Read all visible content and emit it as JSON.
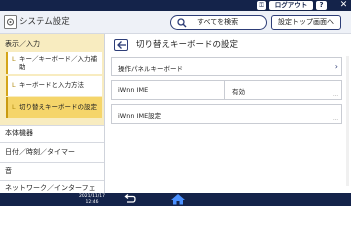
{
  "topbar": {
    "help_label": "?",
    "key_label": "⚿",
    "logout_label": "ログアウト",
    "close_label": "✕"
  },
  "header": {
    "title": "システム設定",
    "search_label": "すべてを検索",
    "top_button_label": "設定トップ画面へ"
  },
  "sidebar": {
    "group_title": "表示／入力",
    "sub_items": [
      {
        "line1": "キー／キーボード／入力補",
        "line2": "助",
        "selected": false
      },
      {
        "line1": "キーボードと入力方法",
        "selected": false
      },
      {
        "line1": "切り替えキーボードの設定",
        "selected": true
      }
    ],
    "items": [
      {
        "label": "本体機器"
      },
      {
        "label": "日付／時刻／タイマー"
      },
      {
        "label": "音"
      },
      {
        "label": "ネットワーク／インターフェ"
      }
    ]
  },
  "main": {
    "title": "切り替えキーボードの設定",
    "rows": [
      {
        "label": "操作パネルキーボード",
        "value": "",
        "kind": "nav"
      },
      {
        "label": "iWnn IME",
        "value": "有効",
        "kind": "value"
      },
      {
        "label": "iWnn IME設定",
        "value": "",
        "kind": "plain"
      }
    ]
  },
  "bottombar": {
    "date": "2021/11/17",
    "time": "12:46"
  },
  "colors": {
    "bar": "#14234a",
    "accent": "#2d3d77",
    "selected": "#f5d56a",
    "group_bg": "#f8ecc0"
  }
}
